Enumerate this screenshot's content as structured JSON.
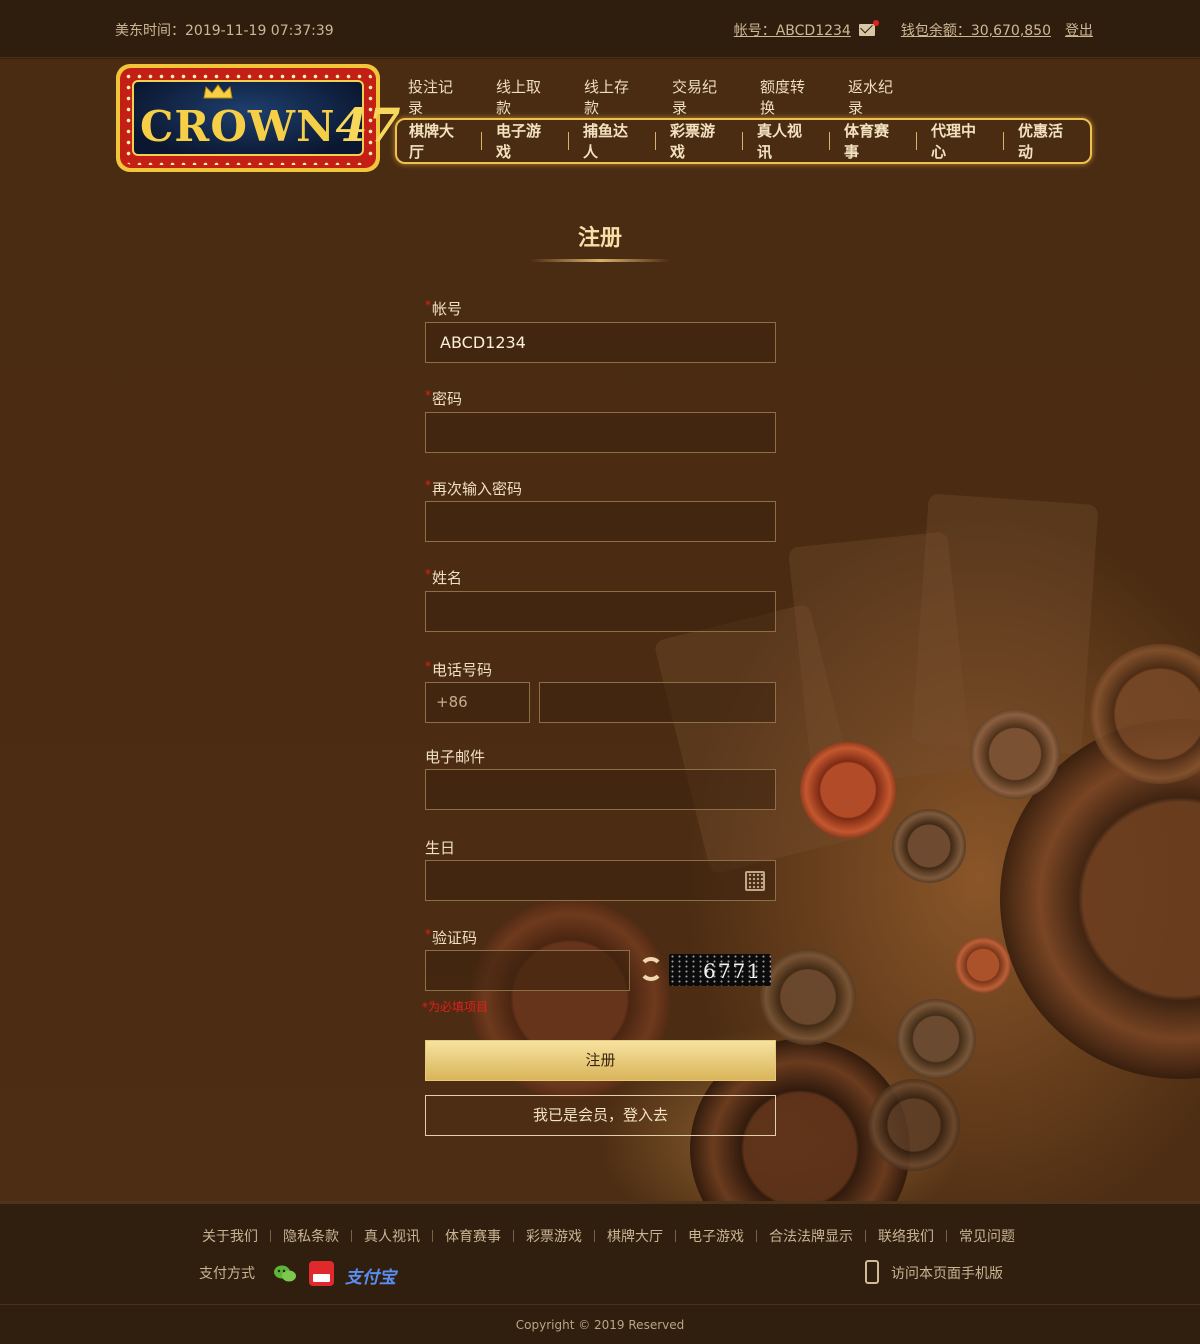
{
  "topbar": {
    "time_label": "美东时间：2019-11-19 07:37:39",
    "account": "帐号：ABCD1234",
    "wallet": "钱包余额：30,670,850",
    "logout": "登出"
  },
  "logo": {
    "brand": "CROWN",
    "number": "47"
  },
  "nav_top": [
    "投注记录",
    "线上取款",
    "线上存款",
    "交易纪录",
    "额度转换",
    "返水纪录"
  ],
  "nav_main": [
    "棋牌大厅",
    "电子游戏",
    "捕鱼达人",
    "彩票游戏",
    "真人视讯",
    "体育赛事",
    "代理中心",
    "优惠活动"
  ],
  "form": {
    "title": "注册",
    "account_label": "帐号",
    "account_value": "ABCD1234",
    "password_label": "密码",
    "confirm_label": "再次输入密码",
    "name_label": "姓名",
    "phone_label": "电话号码",
    "phone_code": "+86",
    "email_label": "电子邮件",
    "birthday_label": "生日",
    "captcha_label": "验证码",
    "captcha_text": "6771",
    "hint": "*为必填项目",
    "submit": "注册",
    "login_link": "我已是会员，登入去"
  },
  "footer": {
    "links": [
      "关于我们",
      "隐私条款",
      "真人视讯",
      "体育赛事",
      "彩票游戏",
      "棋牌大厅",
      "电子游戏",
      "合法法牌显示",
      "联络我们",
      "常见问题"
    ],
    "payment_label": "支付方式",
    "alipay": "支付宝",
    "mobile": "访问本页面手机版",
    "copyright": "Copyright © 2019 Reserved"
  }
}
